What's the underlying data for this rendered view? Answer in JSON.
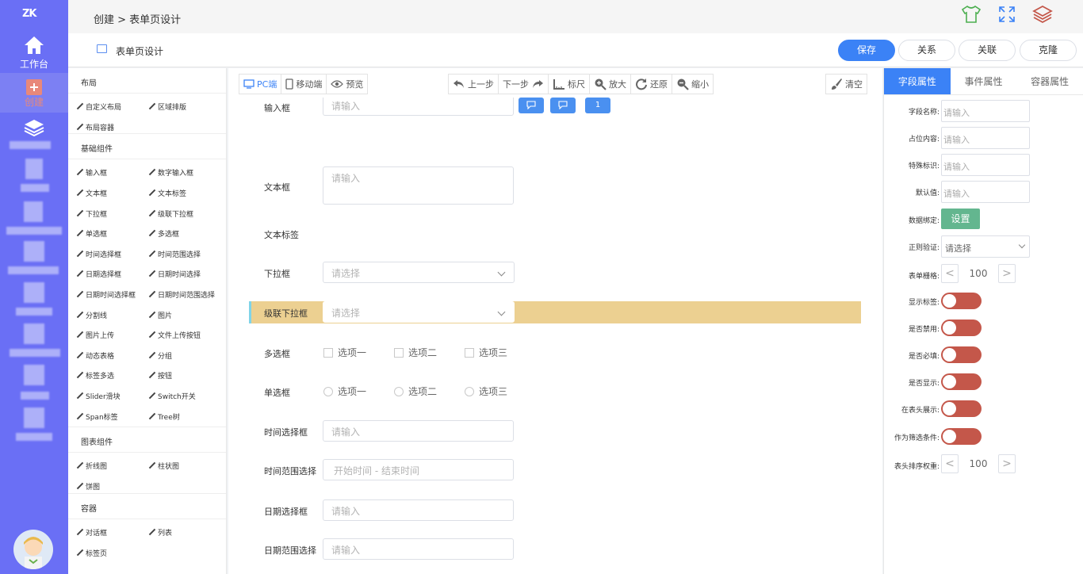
{
  "nav": {
    "logo": "ZK",
    "workbench": "工作台",
    "create": "创建"
  },
  "breadcrumb": "创建 > 表单页设计",
  "subbar": {
    "title": "表单页设计",
    "save": "保存",
    "relation": "关系",
    "associate": "关联",
    "clone": "克隆"
  },
  "palette": {
    "sections": [
      {
        "title": "布局",
        "items": [
          "自定义布局",
          "区域排版",
          "布局容器"
        ]
      },
      {
        "title": "基础组件",
        "items": [
          "输入框",
          "数字输入框",
          "文本框",
          "文本标签",
          "下拉框",
          "级联下拉框",
          "单选框",
          "多选框",
          "时间选择框",
          "时间范围选择",
          "日期选择框",
          "日期时间选择",
          "日期时间选择框",
          "日期时间范围选择",
          "分割线",
          "图片",
          "图片上传",
          "文件上传按钮",
          "动态表格",
          "分组",
          "标签多选",
          "按钮",
          "Slider滑块",
          "Switch开关",
          "Span标签",
          "Tree树"
        ]
      },
      {
        "title": "图表组件",
        "items": [
          "折线图",
          "柱状图",
          "饼图"
        ]
      },
      {
        "title": "容器",
        "items": [
          "对话框",
          "列表",
          "标签页"
        ]
      }
    ]
  },
  "toolbar": {
    "pc": "PC端",
    "mobile": "移动端",
    "preview": "预览",
    "undo": "上一步",
    "redo": "下一步",
    "ruler": "标尺",
    "zoom_in": "放大",
    "reset": "还原",
    "zoom_out": "缩小",
    "clear": "清空"
  },
  "form": {
    "input_label": "输入框",
    "input_placeholder": "请输入",
    "input_btn3": "1",
    "textarea_label": "文本框",
    "textarea_placeholder": "请输入",
    "textlabel_label": "文本标签",
    "select_label": "下拉框",
    "select_placeholder": "请选择",
    "cascader_label": "级联下拉框",
    "cascader_placeholder": "请选择",
    "checkbox_label": "多选框",
    "checkbox_options": [
      "选项一",
      "选项二",
      "选项三"
    ],
    "radio_label": "单选框",
    "radio_options": [
      "选项一",
      "选项二",
      "选项三"
    ],
    "time_label": "时间选择框",
    "time_placeholder": "请输入",
    "timerange_label": "时间范围选择",
    "timerange_placeholder": "开始时间 - 结束时间",
    "date_label": "日期选择框",
    "date_placeholder": "请输入",
    "daterange_label": "日期范围选择",
    "daterange_placeholder": "请输入"
  },
  "props": {
    "tabs": [
      "字段属性",
      "事件属性",
      "容器属性"
    ],
    "field_name": "字段名称:",
    "placeholder_content": "占位内容:",
    "special_id": "特殊标识:",
    "default_value": "默认值:",
    "input_placeholder": "请输入",
    "data_binding": "数据绑定:",
    "set_button": "设置",
    "regex": "正则验证:",
    "regex_placeholder": "请选择",
    "grid": "表单栅格:",
    "grid_value": "100",
    "show_label": "显示标签:",
    "disabled": "是否禁用:",
    "required": "是否必填:",
    "visible": "是否显示:",
    "show_in_header": "在表头展示:",
    "as_filter": "作为筛选条件:",
    "header_sort": "表头排序权重:",
    "sort_value": "100"
  },
  "colors": {
    "nav_bg": "#6a6ff5",
    "primary": "#3b82f6",
    "highlight_row": "#ecd091",
    "toggle": "#c4574a",
    "set_button": "#63b68f"
  }
}
